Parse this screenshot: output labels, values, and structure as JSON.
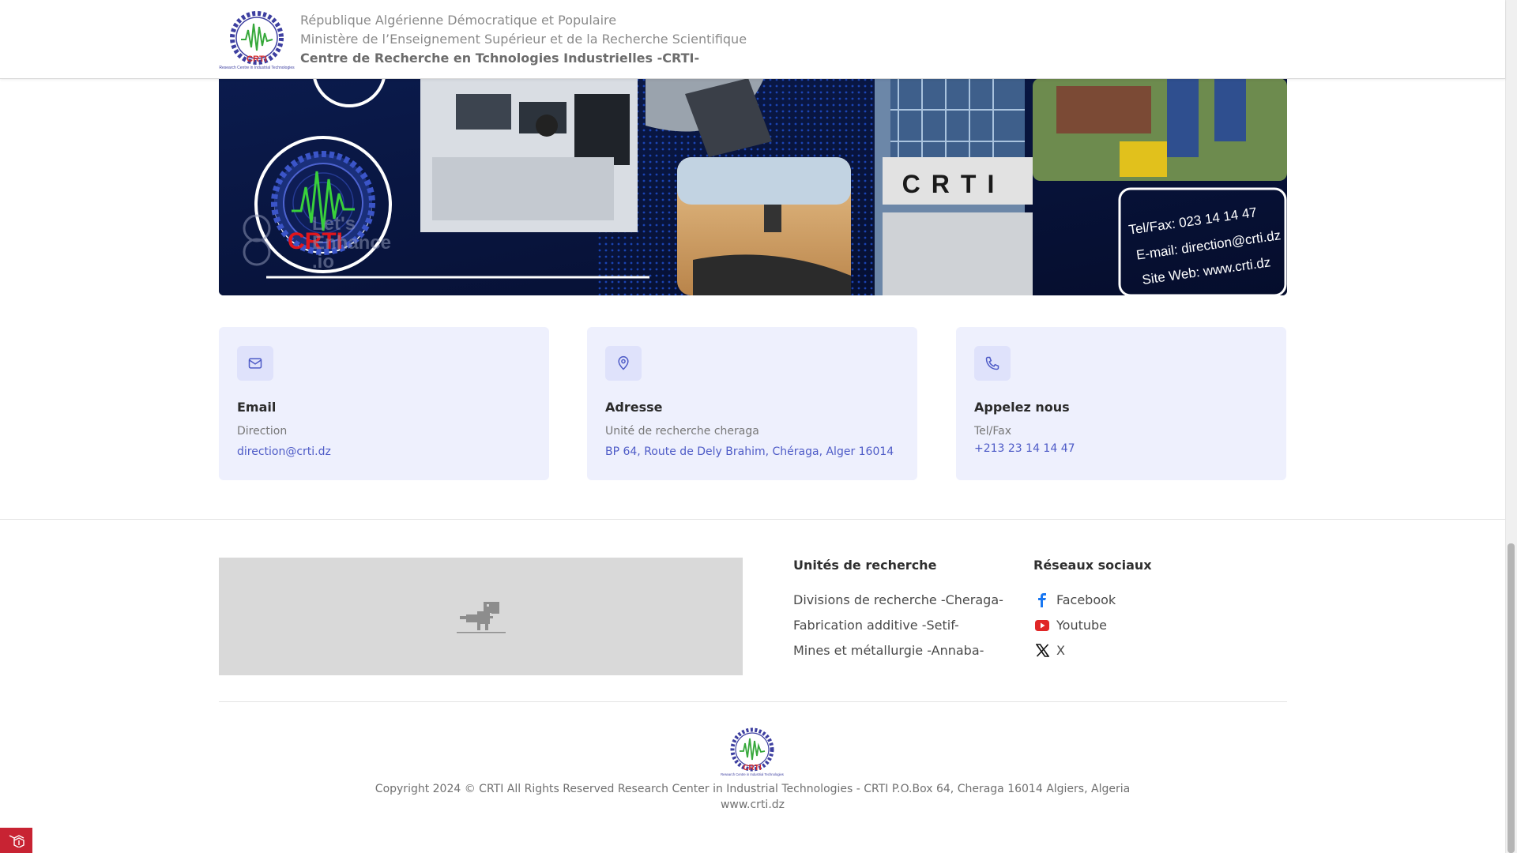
{
  "header": {
    "line1": "République Algérienne Démocratique et Populaire",
    "line2": "Ministère de l’Enseignement Supérieur et de la Recherche Scientifique",
    "line3": "Centre de Recherche en Tchnologies Industrielles -CRTI-",
    "logo_text": "CRTI",
    "logo_caption": "Research Centre in Industrial Technologies"
  },
  "banner": {
    "logo_text": "CRTI",
    "building_text": "CRTI",
    "watermark": [
      "Let's",
      "Enhance",
      ".io"
    ],
    "contact_lines": [
      "Tel/Fax: 023 14 14 47",
      "E-mail: direction@crti.dz",
      "Site Web: www.crti.dz"
    ]
  },
  "cards": [
    {
      "icon": "mail-icon",
      "title": "Email",
      "subtitle": "Direction",
      "value": "direction@crti.dz"
    },
    {
      "icon": "location-pin-icon",
      "title": "Adresse",
      "subtitle": "Unité de recherche cheraga",
      "value": "BP 64, Route de Dely Brahim, Chéraga, Alger 16014"
    },
    {
      "icon": "phone-icon",
      "title": "Appelez nous",
      "subtitle": "Tel/Fax",
      "value": "+213 23 14 14 47"
    }
  ],
  "footer": {
    "units_title": "Unités de recherche",
    "units": [
      "Divisions de recherche -Cheraga-",
      "Fabrication additive -Setif-",
      "Mines et métallurgie -Annaba-"
    ],
    "social_title": "Réseaux sociaux",
    "social": [
      {
        "icon": "facebook-icon",
        "label": "Facebook"
      },
      {
        "icon": "youtube-icon",
        "label": "Youtube"
      },
      {
        "icon": "x-icon",
        "label": "X"
      }
    ],
    "copyright": "Copyright 2024 © CRTI All Rights Reserved Research Center in Industrial Technologies - CRTI P.O.Box 64, Cheraga 16014 Algiers, Algeria",
    "website": "www.crti.dz"
  },
  "colors": {
    "accent": "#4e5bc7",
    "card_bg": "#eef0fd",
    "icon_bg": "#dfe2fb",
    "banner_bg": "#08133a",
    "youtube": "#e02727",
    "facebook": "#1877f2",
    "debug_badge": "#c82333"
  }
}
